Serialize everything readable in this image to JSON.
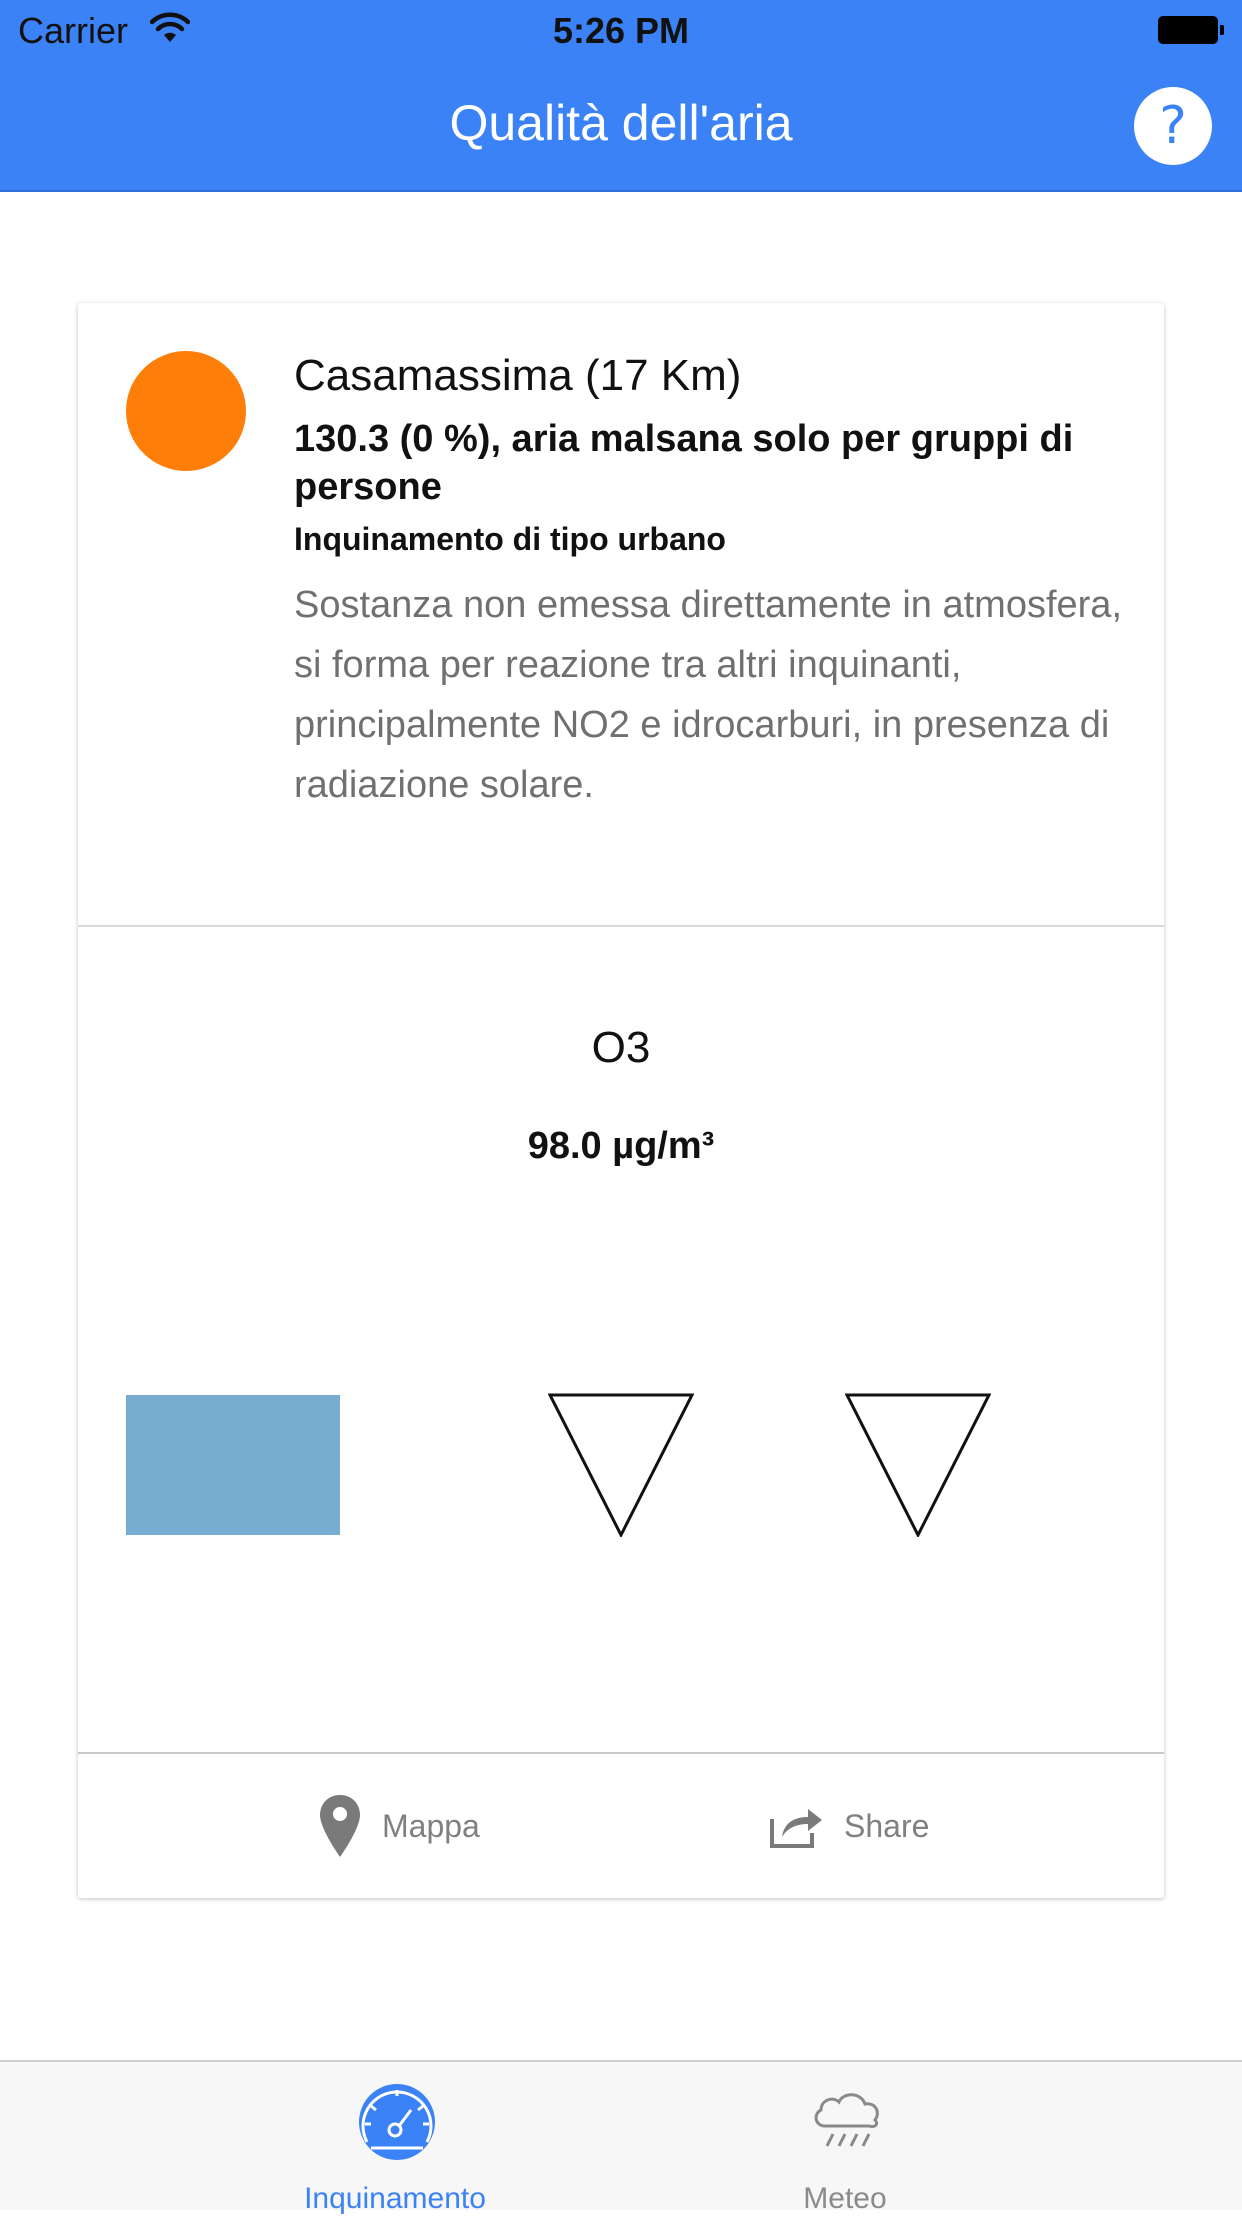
{
  "status_bar": {
    "carrier": "Carrier",
    "time": "5:26 PM"
  },
  "header": {
    "title": "Qualità dell'aria",
    "help_label": "?"
  },
  "station": {
    "name": "Casamassima (17 Km)",
    "aqi_text": "130.3 (0 %), aria malsana solo per gruppi di persone",
    "pollution_type": "Inquinamento di tipo urbano",
    "description": "Sostanza non emessa direttamente in atmosfera, si forma per reazione tra altri inquinanti, principalmente NO2 e idrocarburi, in presenza di radiazione solare.",
    "status_color": "#fd7f0a"
  },
  "pollutant": {
    "name": "O3",
    "concentration": "98.0 µg/m³"
  },
  "indicators": {
    "bar_color": "#79acd1"
  },
  "actions": {
    "map_label": "Mappa",
    "share_label": "Share"
  },
  "tabs": [
    {
      "label": "Inquinamento",
      "icon": "speedometer-icon",
      "active": true
    },
    {
      "label": "Meteo",
      "icon": "rain-cloud-icon",
      "active": false
    }
  ],
  "colors": {
    "accent": "#3b82f6",
    "header_bg": "#3b82f6"
  }
}
